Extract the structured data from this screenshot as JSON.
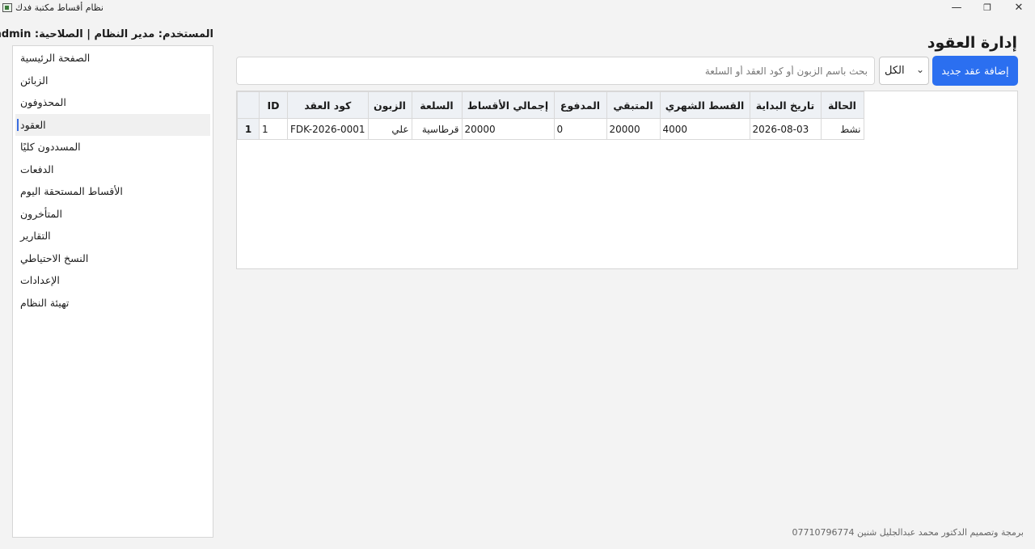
{
  "window": {
    "title": "نظام أقساط مكتبة فدك",
    "minimize": "—",
    "maximize": "❐",
    "close": "✕"
  },
  "user_info": "المستخدم: مدير النظام | الصلاحية: admin",
  "sidebar": {
    "items": [
      {
        "label": "الصفحة الرئيسية",
        "active": false
      },
      {
        "label": "الزبائن",
        "active": false
      },
      {
        "label": "المحذوفون",
        "active": false
      },
      {
        "label": "العقود",
        "active": true
      },
      {
        "label": "المسددون كليًا",
        "active": false
      },
      {
        "label": "الدفعات",
        "active": false
      },
      {
        "label": "الأقساط المستحقة اليوم",
        "active": false
      },
      {
        "label": "المتأخرون",
        "active": false
      },
      {
        "label": "التقارير",
        "active": false
      },
      {
        "label": "النسخ الاحتياطي",
        "active": false
      },
      {
        "label": "الإعدادات",
        "active": false
      },
      {
        "label": "تهيئة النظام",
        "active": false
      }
    ]
  },
  "main": {
    "title": "إدارة العقود",
    "search": {
      "value": "",
      "placeholder": "بحث باسم الزبون أو كود العقد أو السلعة"
    },
    "filter": {
      "selected": "الكل"
    },
    "add_button": "إضافة عقد جديد",
    "table": {
      "headers": [
        "ID",
        "كود العقد",
        "الزبون",
        "السلعة",
        "إجمالي الأقساط",
        "المدفوع",
        "المتبقي",
        "القسط الشهري",
        "تاريخ البداية",
        "الحالة"
      ],
      "rows": [
        {
          "row_number": "1",
          "cells": [
            "1",
            "FDK-2026-0001",
            "علي",
            "قرطاسية",
            "20000",
            "0",
            "20000",
            "4000",
            "2026-08-03",
            "نشط"
          ]
        }
      ]
    }
  },
  "footer": "برمجة وتصميم الدكتور محمد عبدالجليل شنين 07710796774",
  "colors": {
    "accent": "#2b6ff0",
    "active_indicator": "#3b6de0"
  }
}
